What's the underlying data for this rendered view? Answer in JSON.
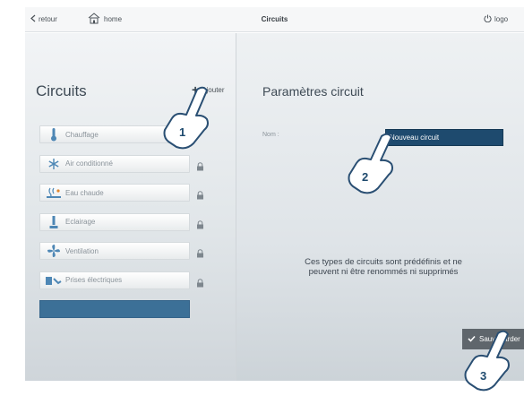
{
  "topbar": {
    "back_label": "retour",
    "home_label": "home",
    "title": "Circuits",
    "logout_label": "logo"
  },
  "left_panel": {
    "heading": "Circuits",
    "add_label": "Ajouter",
    "items": [
      {
        "label": "Chauffage",
        "icon": "thermometer-icon",
        "locked": false
      },
      {
        "label": "Air conditionné",
        "icon": "snowflake-icon",
        "locked": true
      },
      {
        "label": "Eau chaude",
        "icon": "hot-water-icon",
        "locked": true
      },
      {
        "label": "Eclairage",
        "icon": "lamp-icon",
        "locked": true
      },
      {
        "label": "Ventilation",
        "icon": "fan-icon",
        "locked": true
      },
      {
        "label": "Prises électriques",
        "icon": "plug-icon",
        "locked": true
      }
    ],
    "new_item_label": ""
  },
  "right_panel": {
    "heading": "Paramètres circuit",
    "name_label": "Nom :",
    "name_value": "Nouveau circuit",
    "info_text_line1": "Ces types de circuits sont prédéfinis et ne",
    "info_text_line2": "peuvent ni être renommés ni supprimés",
    "save_label": "Sauvegarder"
  },
  "callouts": [
    "1",
    "2",
    "3"
  ],
  "colors": {
    "accent": "#3c7097",
    "input_bg": "#1e4a6e",
    "save_bg": "#5f666c",
    "heading": "#3e4a55"
  }
}
